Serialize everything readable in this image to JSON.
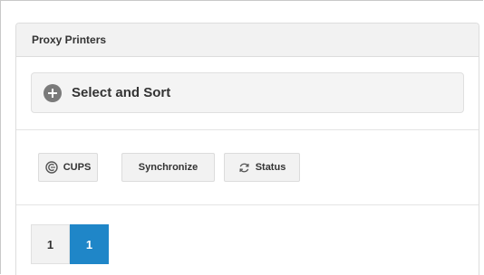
{
  "panel": {
    "title": "Proxy Printers"
  },
  "select_sort": {
    "label": "Select and Sort",
    "icon": "plus-circle-icon"
  },
  "toolbar": {
    "buttons": [
      {
        "label": "CUPS",
        "icon": "cups-icon"
      },
      {
        "label": "Synchronize"
      },
      {
        "label": "Status",
        "icon": "refresh-icon"
      }
    ]
  },
  "pagination": {
    "pages": [
      {
        "label": "1",
        "active": false
      },
      {
        "label": "1",
        "active": true
      }
    ],
    "active_color": "#1f86c8"
  }
}
